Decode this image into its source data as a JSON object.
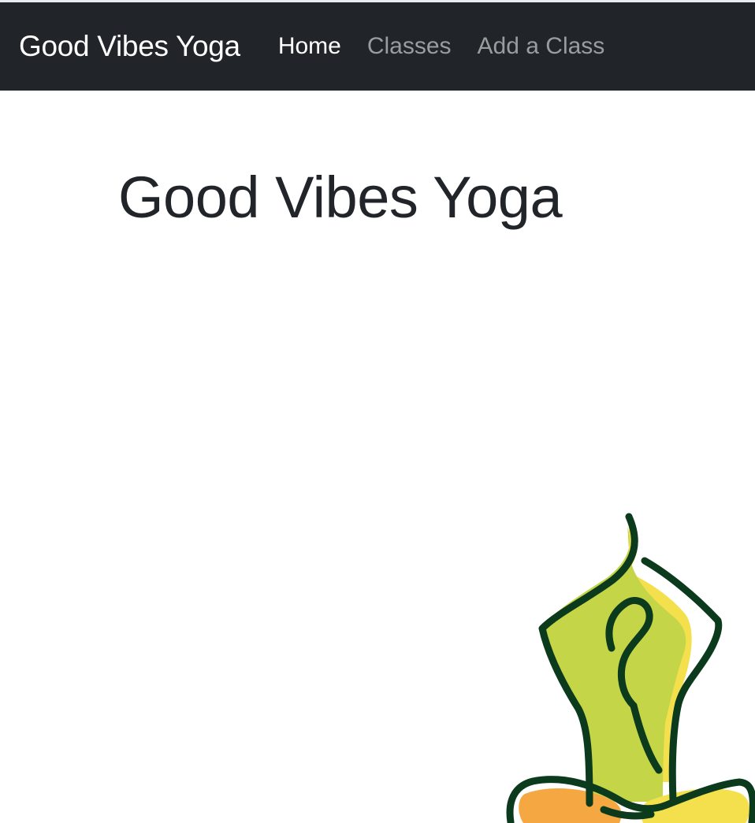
{
  "nav": {
    "brand": "Good Vibes Yoga",
    "links": [
      {
        "label": "Home",
        "active": true
      },
      {
        "label": "Classes",
        "active": false
      },
      {
        "label": "Add a Class",
        "active": false
      }
    ]
  },
  "hero": {
    "title": "Good Vibes Yoga"
  },
  "logo": {
    "icon": "yoga-meditation-figure-icon"
  },
  "colors": {
    "navbar_bg": "#212529",
    "nav_active": "#ffffff",
    "nav_inactive": "#9a9da0",
    "heading": "#212529",
    "logo_outline": "#0b3a1c",
    "logo_green": "#c5d548",
    "logo_yellow": "#f4e04d",
    "logo_orange": "#f5a742"
  }
}
